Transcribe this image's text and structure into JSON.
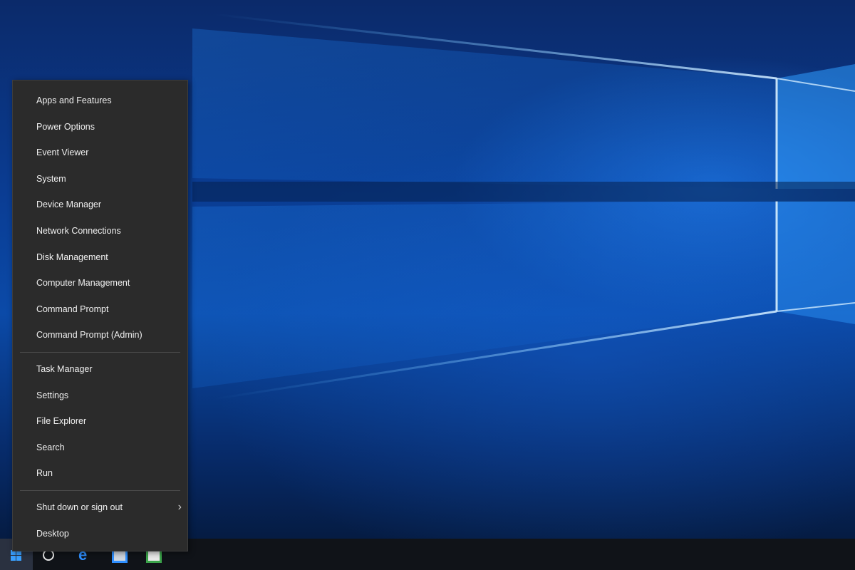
{
  "menu": {
    "groups": [
      {
        "items": [
          {
            "label": "Apps and Features"
          },
          {
            "label": "Power Options"
          },
          {
            "label": "Event Viewer"
          },
          {
            "label": "System"
          },
          {
            "label": "Device Manager"
          },
          {
            "label": "Network Connections"
          },
          {
            "label": "Disk Management"
          },
          {
            "label": "Computer Management"
          },
          {
            "label": "Command Prompt"
          },
          {
            "label": "Command Prompt (Admin)"
          }
        ]
      },
      {
        "items": [
          {
            "label": "Task Manager"
          },
          {
            "label": "Settings"
          },
          {
            "label": "File Explorer"
          },
          {
            "label": "Search"
          },
          {
            "label": "Run"
          }
        ]
      },
      {
        "items": [
          {
            "label": "Shut down or sign out",
            "submenu": true
          },
          {
            "label": "Desktop"
          }
        ]
      }
    ]
  },
  "taskbar": {
    "icons": [
      {
        "name": "start-button",
        "icon": "windows-logo-icon"
      },
      {
        "name": "cortana-button",
        "icon": "cortana-ring-icon"
      },
      {
        "name": "edge-button",
        "icon": "edge-icon"
      },
      {
        "name": "store-button",
        "icon": "store-icon"
      },
      {
        "name": "app-button",
        "icon": "app-tile-icon"
      }
    ]
  },
  "colors": {
    "menu_bg": "#2b2b2b",
    "menu_text": "#f0f0f0",
    "accent": "#3aa0ff",
    "taskbar_bg": "#101318"
  }
}
